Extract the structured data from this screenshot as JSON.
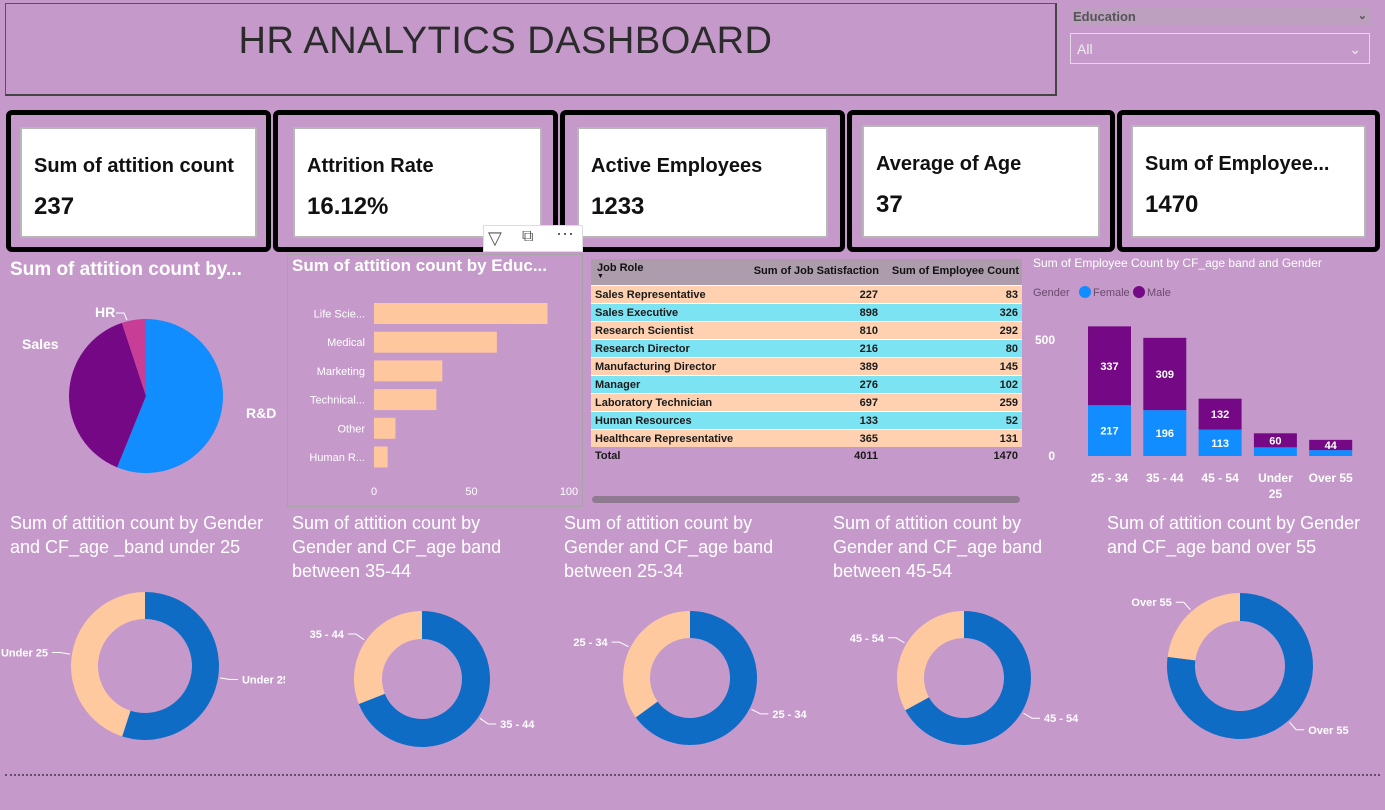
{
  "header": {
    "title": "HR ANALYTICS DASHBOARD"
  },
  "slicer": {
    "label": "Education",
    "value": "All"
  },
  "kpis": [
    {
      "label": "Sum of attition count",
      "value": "237"
    },
    {
      "label": "Attrition Rate",
      "value": "16.12%"
    },
    {
      "label": "Active Employees",
      "value": "1233"
    },
    {
      "label": "Average of Age",
      "value": "37"
    },
    {
      "label": "Sum of Employee...",
      "value": "1470"
    }
  ],
  "colors": {
    "background": "#c59acb",
    "female": "#118dff",
    "male": "#750985",
    "hr": "#c83d95",
    "peach": "#ffc79e",
    "donut_blue": "#0f6cc4",
    "donut_peach": "#ffc9a0"
  },
  "toolbar": {
    "filter_icon": "filter-icon",
    "focus_icon": "focus-mode-icon",
    "more_icon": "more-options-icon"
  },
  "table": {
    "headers": [
      "Job Role",
      "Sum of Job Satisfaction",
      "Sum of Employee Count"
    ],
    "rows": [
      [
        "Sales Representative",
        "227",
        "83"
      ],
      [
        "Sales Executive",
        "898",
        "326"
      ],
      [
        "Research Scientist",
        "810",
        "292"
      ],
      [
        "Research Director",
        "216",
        "80"
      ],
      [
        "Manufacturing Director",
        "389",
        "145"
      ],
      [
        "Manager",
        "276",
        "102"
      ],
      [
        "Laboratory Technician",
        "697",
        "259"
      ],
      [
        "Human Resources",
        "133",
        "52"
      ],
      [
        "Healthcare Representative",
        "365",
        "131"
      ]
    ],
    "total": [
      "Total",
      "4011",
      "1470"
    ]
  },
  "chart_data": [
    {
      "type": "pie",
      "title": "Sum of attition count by...",
      "categories": [
        "R&D",
        "Sales",
        "HR"
      ],
      "values": [
        133,
        92,
        12
      ]
    },
    {
      "type": "bar",
      "orientation": "horizontal",
      "title": "Sum of attition count by Educ...",
      "categories": [
        "Life Scie...",
        "Medical",
        "Marketing",
        "Technical...",
        "Other",
        "Human R..."
      ],
      "values": [
        89,
        63,
        35,
        32,
        11,
        7
      ],
      "xlim": [
        0,
        100
      ],
      "xticks": [
        "0",
        "50",
        "100"
      ]
    },
    {
      "type": "bar",
      "stacked": true,
      "title": "Sum of Employee Count by CF_age band and Gender",
      "legend_title": "Gender",
      "categories": [
        "25 - 34",
        "35 - 44",
        "45 - 54",
        "Under 25",
        "Over 55"
      ],
      "series": [
        {
          "name": "Female",
          "values": [
            217,
            196,
            113,
            37,
            25
          ],
          "labels": [
            "217",
            "196",
            "113",
            "",
            ""
          ]
        },
        {
          "name": "Male",
          "values": [
            337,
            309,
            132,
            60,
            44
          ],
          "labels": [
            "337",
            "309",
            "132",
            "60",
            "44"
          ]
        }
      ],
      "ylim": [
        0,
        560
      ],
      "yticks": [
        "0",
        "500"
      ]
    },
    {
      "type": "pie",
      "donut": true,
      "title": "Sum of attition count by Gender and CF_age _band under 25",
      "label": "Under 25",
      "series": [
        {
          "name": "Male",
          "value": 55
        },
        {
          "name": "Female",
          "value": 45
        }
      ]
    },
    {
      "type": "pie",
      "donut": true,
      "title": "Sum of attition count by Gender and CF_age band between 35-44",
      "label": "35 - 44",
      "series": [
        {
          "name": "Male",
          "value": 69
        },
        {
          "name": "Female",
          "value": 31
        }
      ]
    },
    {
      "type": "pie",
      "donut": true,
      "title": "Sum of attition count by Gender and CF_age band between 25-34",
      "label": "25 - 34",
      "series": [
        {
          "name": "Male",
          "value": 65
        },
        {
          "name": "Female",
          "value": 35
        }
      ]
    },
    {
      "type": "pie",
      "donut": true,
      "title": "Sum of attition count by Gender and CF_age band between 45-54",
      "label": "45 - 54",
      "series": [
        {
          "name": "Male",
          "value": 67
        },
        {
          "name": "Female",
          "value": 33
        }
      ]
    },
    {
      "type": "pie",
      "donut": true,
      "title": "Sum of attition count by Gender and CF_age band over 55",
      "label": "Over 55",
      "series": [
        {
          "name": "Male",
          "value": 77
        },
        {
          "name": "Female",
          "value": 23
        }
      ]
    }
  ]
}
